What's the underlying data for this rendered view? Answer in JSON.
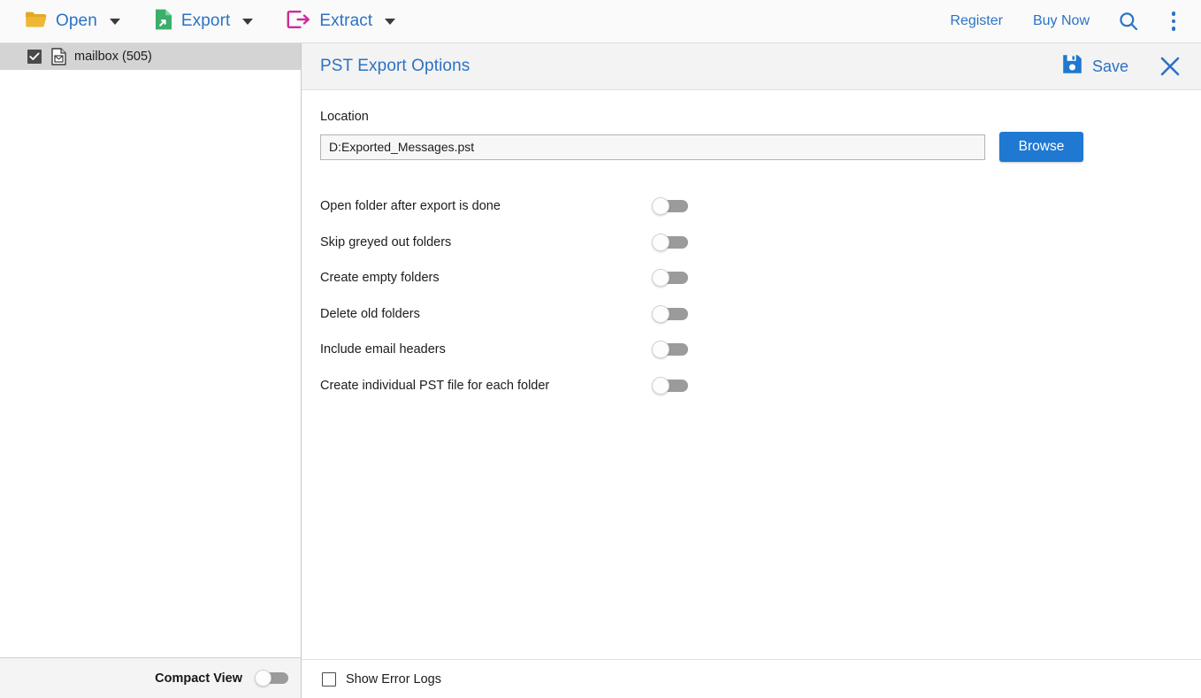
{
  "toolbar": {
    "items": [
      {
        "label": "Open",
        "icon": "folder-open-icon",
        "color": "#E3A921"
      },
      {
        "label": "Export",
        "icon": "export-file-icon",
        "color": "#3BAE6B"
      },
      {
        "label": "Extract",
        "icon": "extract-arrow-icon",
        "color": "#CE2C99"
      }
    ],
    "register_label": "Register",
    "buy_now_label": "Buy Now",
    "search_icon": "search-icon",
    "menu_icon": "kebab-menu-icon",
    "link_color": "#2b72c4"
  },
  "sidebar": {
    "tree": [
      {
        "label": "mailbox (505)",
        "checked": true,
        "icon": "mail-file-icon",
        "selected": true
      }
    ],
    "footer": {
      "compact_view_label": "Compact View",
      "compact_view_on": false
    }
  },
  "panel": {
    "title": "PST Export Options",
    "save_label": "Save",
    "save_icon": "floppy-disk-save-icon",
    "close_icon": "close-x-icon",
    "location": {
      "label": "Location",
      "value": "D:Exported_Messages.pst",
      "placeholder": "D:Exported_Messages.pst",
      "browse_label": "Browse",
      "browse_color": "#1f78d1"
    },
    "options": [
      {
        "label": "Open folder after export is done",
        "on": false
      },
      {
        "label": "Skip greyed out folders",
        "on": false
      },
      {
        "label": "Create empty folders",
        "on": false
      },
      {
        "label": "Delete old folders",
        "on": false
      },
      {
        "label": "Include email headers",
        "on": false
      },
      {
        "label": "Create individual PST file for each folder",
        "on": false
      }
    ],
    "footer": {
      "show_error_logs_label": "Show Error Logs",
      "show_error_logs_checked": false
    }
  }
}
